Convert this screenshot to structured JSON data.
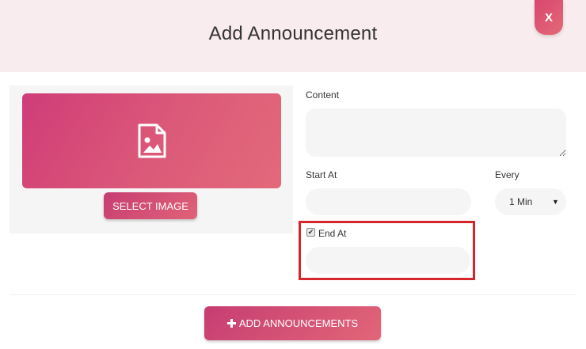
{
  "modal": {
    "title": "Add Announcement",
    "close_label": "X"
  },
  "image": {
    "icon": "image-icon",
    "select_label": "SELECT IMAGE"
  },
  "form": {
    "content_label": "Content",
    "content_value": "",
    "start_label": "Start At",
    "start_value": "",
    "every_label": "Every",
    "every_selected": "1 Min",
    "end_label": "End At",
    "end_checked": true,
    "end_value": ""
  },
  "footer": {
    "add_icon": "plus-icon",
    "add_label": "ADD ANNOUNCEMENTS"
  },
  "colors": {
    "accent": "#d4466f",
    "highlight": "#d7262b",
    "header_bg": "#f9ecee"
  }
}
